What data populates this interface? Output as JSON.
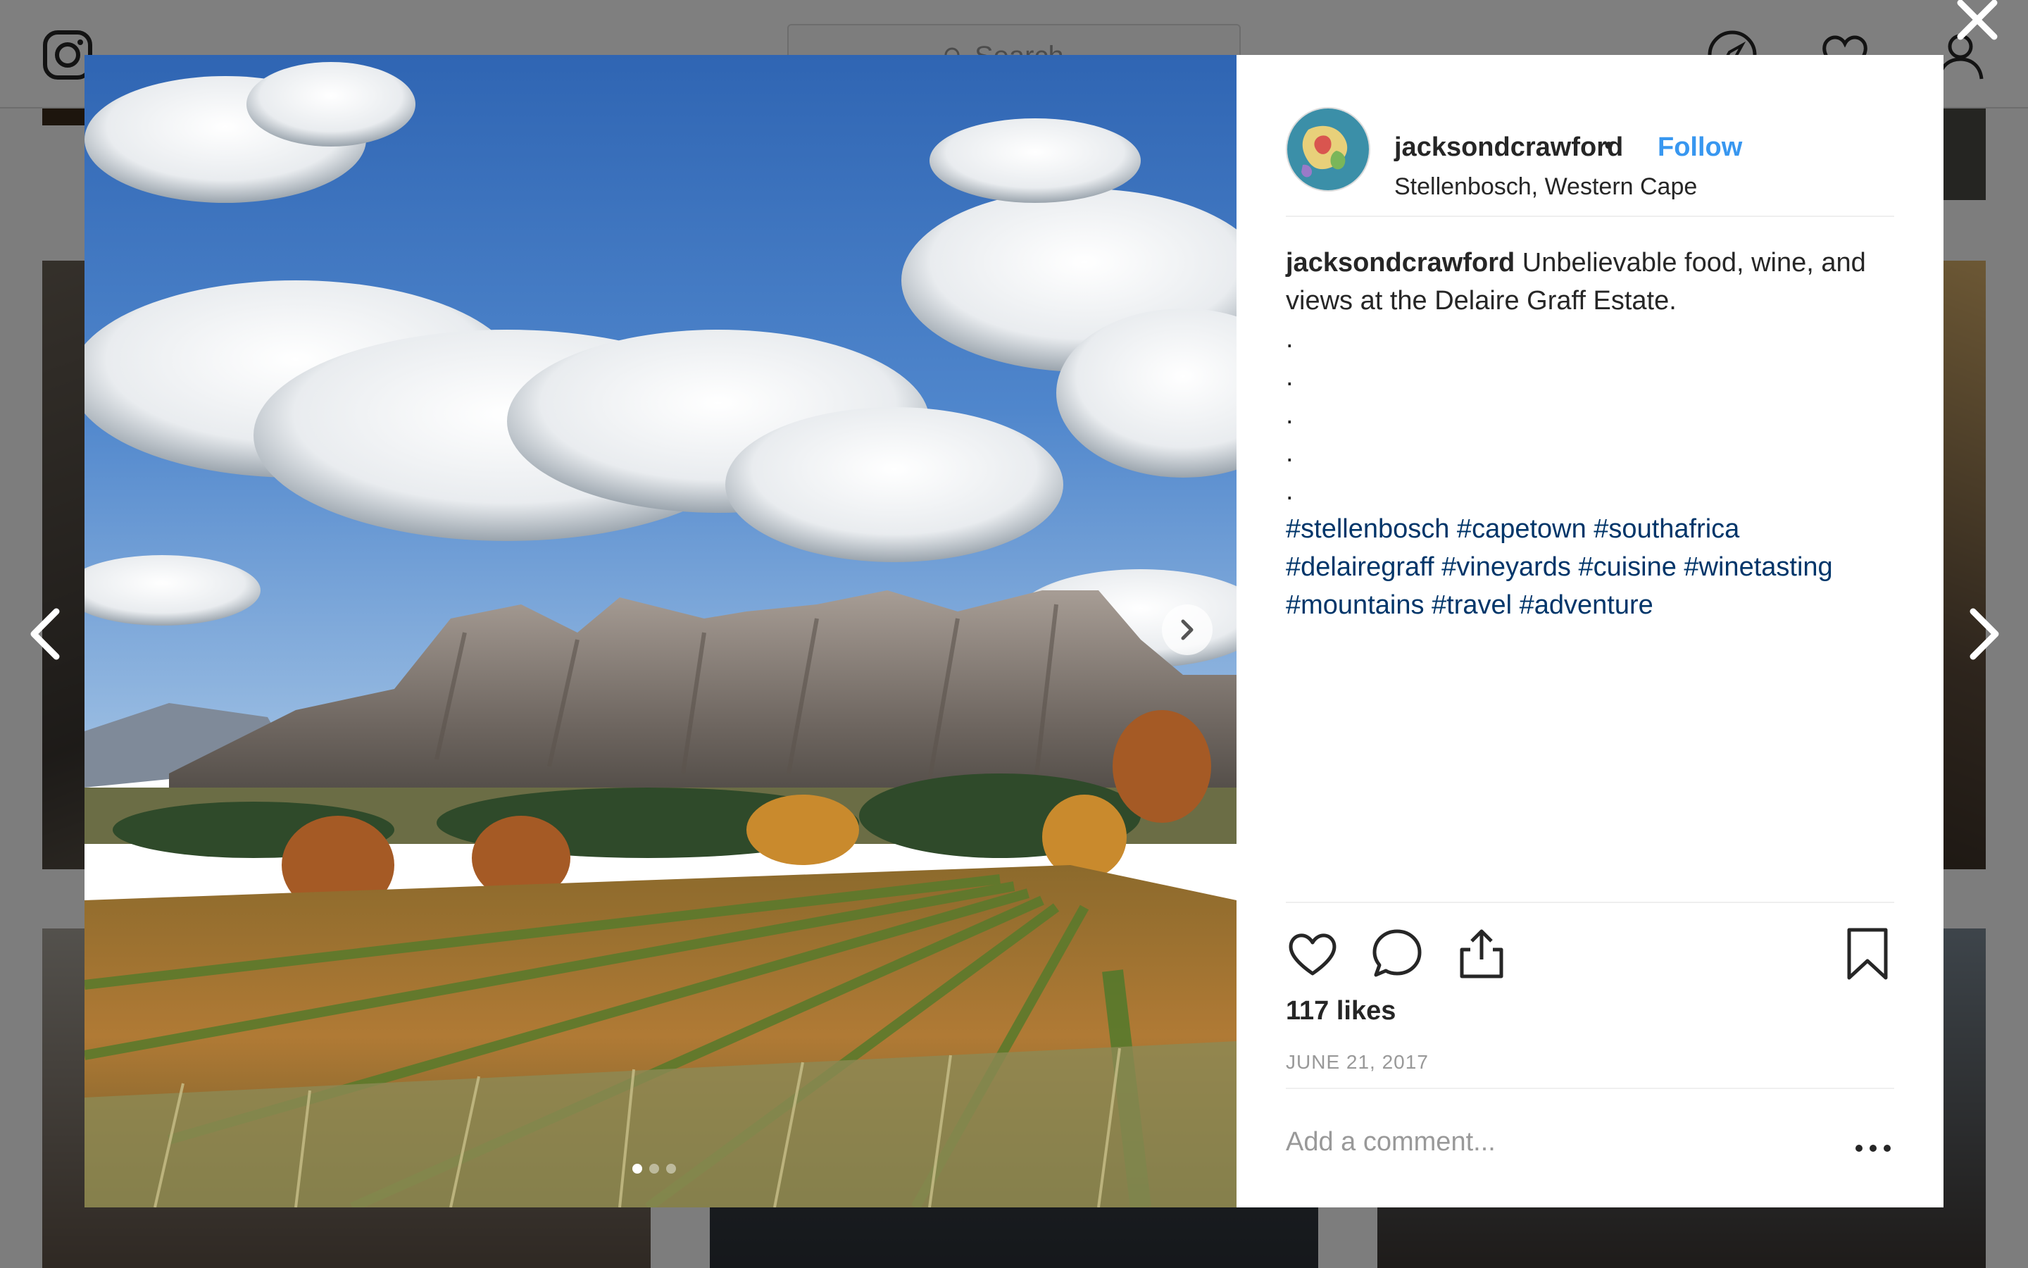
{
  "background": {
    "search_placeholder": "Search"
  },
  "post": {
    "username": "jacksondcrawford",
    "separator": "•",
    "follow_label": "Follow",
    "location": "Stellenbosch, Western Cape",
    "caption_text": "Unbelievable food, wine, and views at the Delaire Graff Estate.",
    "caption_dots": [
      ".",
      ".",
      ".",
      ".",
      "."
    ],
    "hashtags_line1": "#stellenbosch #capetown #southafrica",
    "hashtags_line2": "#delairegraff #vineyards #cuisine #winetasting",
    "hashtags_line3": "#mountains #travel #adventure",
    "likes": "117 likes",
    "date": "JUNE 21, 2017",
    "comment_placeholder": "Add a comment..."
  },
  "icons": {
    "close": "close-icon",
    "prev": "chevron-left-icon",
    "next": "chevron-right-icon",
    "like": "heart-icon",
    "comment": "comment-icon",
    "share": "share-icon",
    "save": "bookmark-icon",
    "more": "more-icon"
  },
  "carousel": {
    "count": 3,
    "active_index": 0
  },
  "colors": {
    "link_blue": "#3897f0",
    "hashtag": "#003569",
    "text": "#262626",
    "muted": "#999999"
  }
}
